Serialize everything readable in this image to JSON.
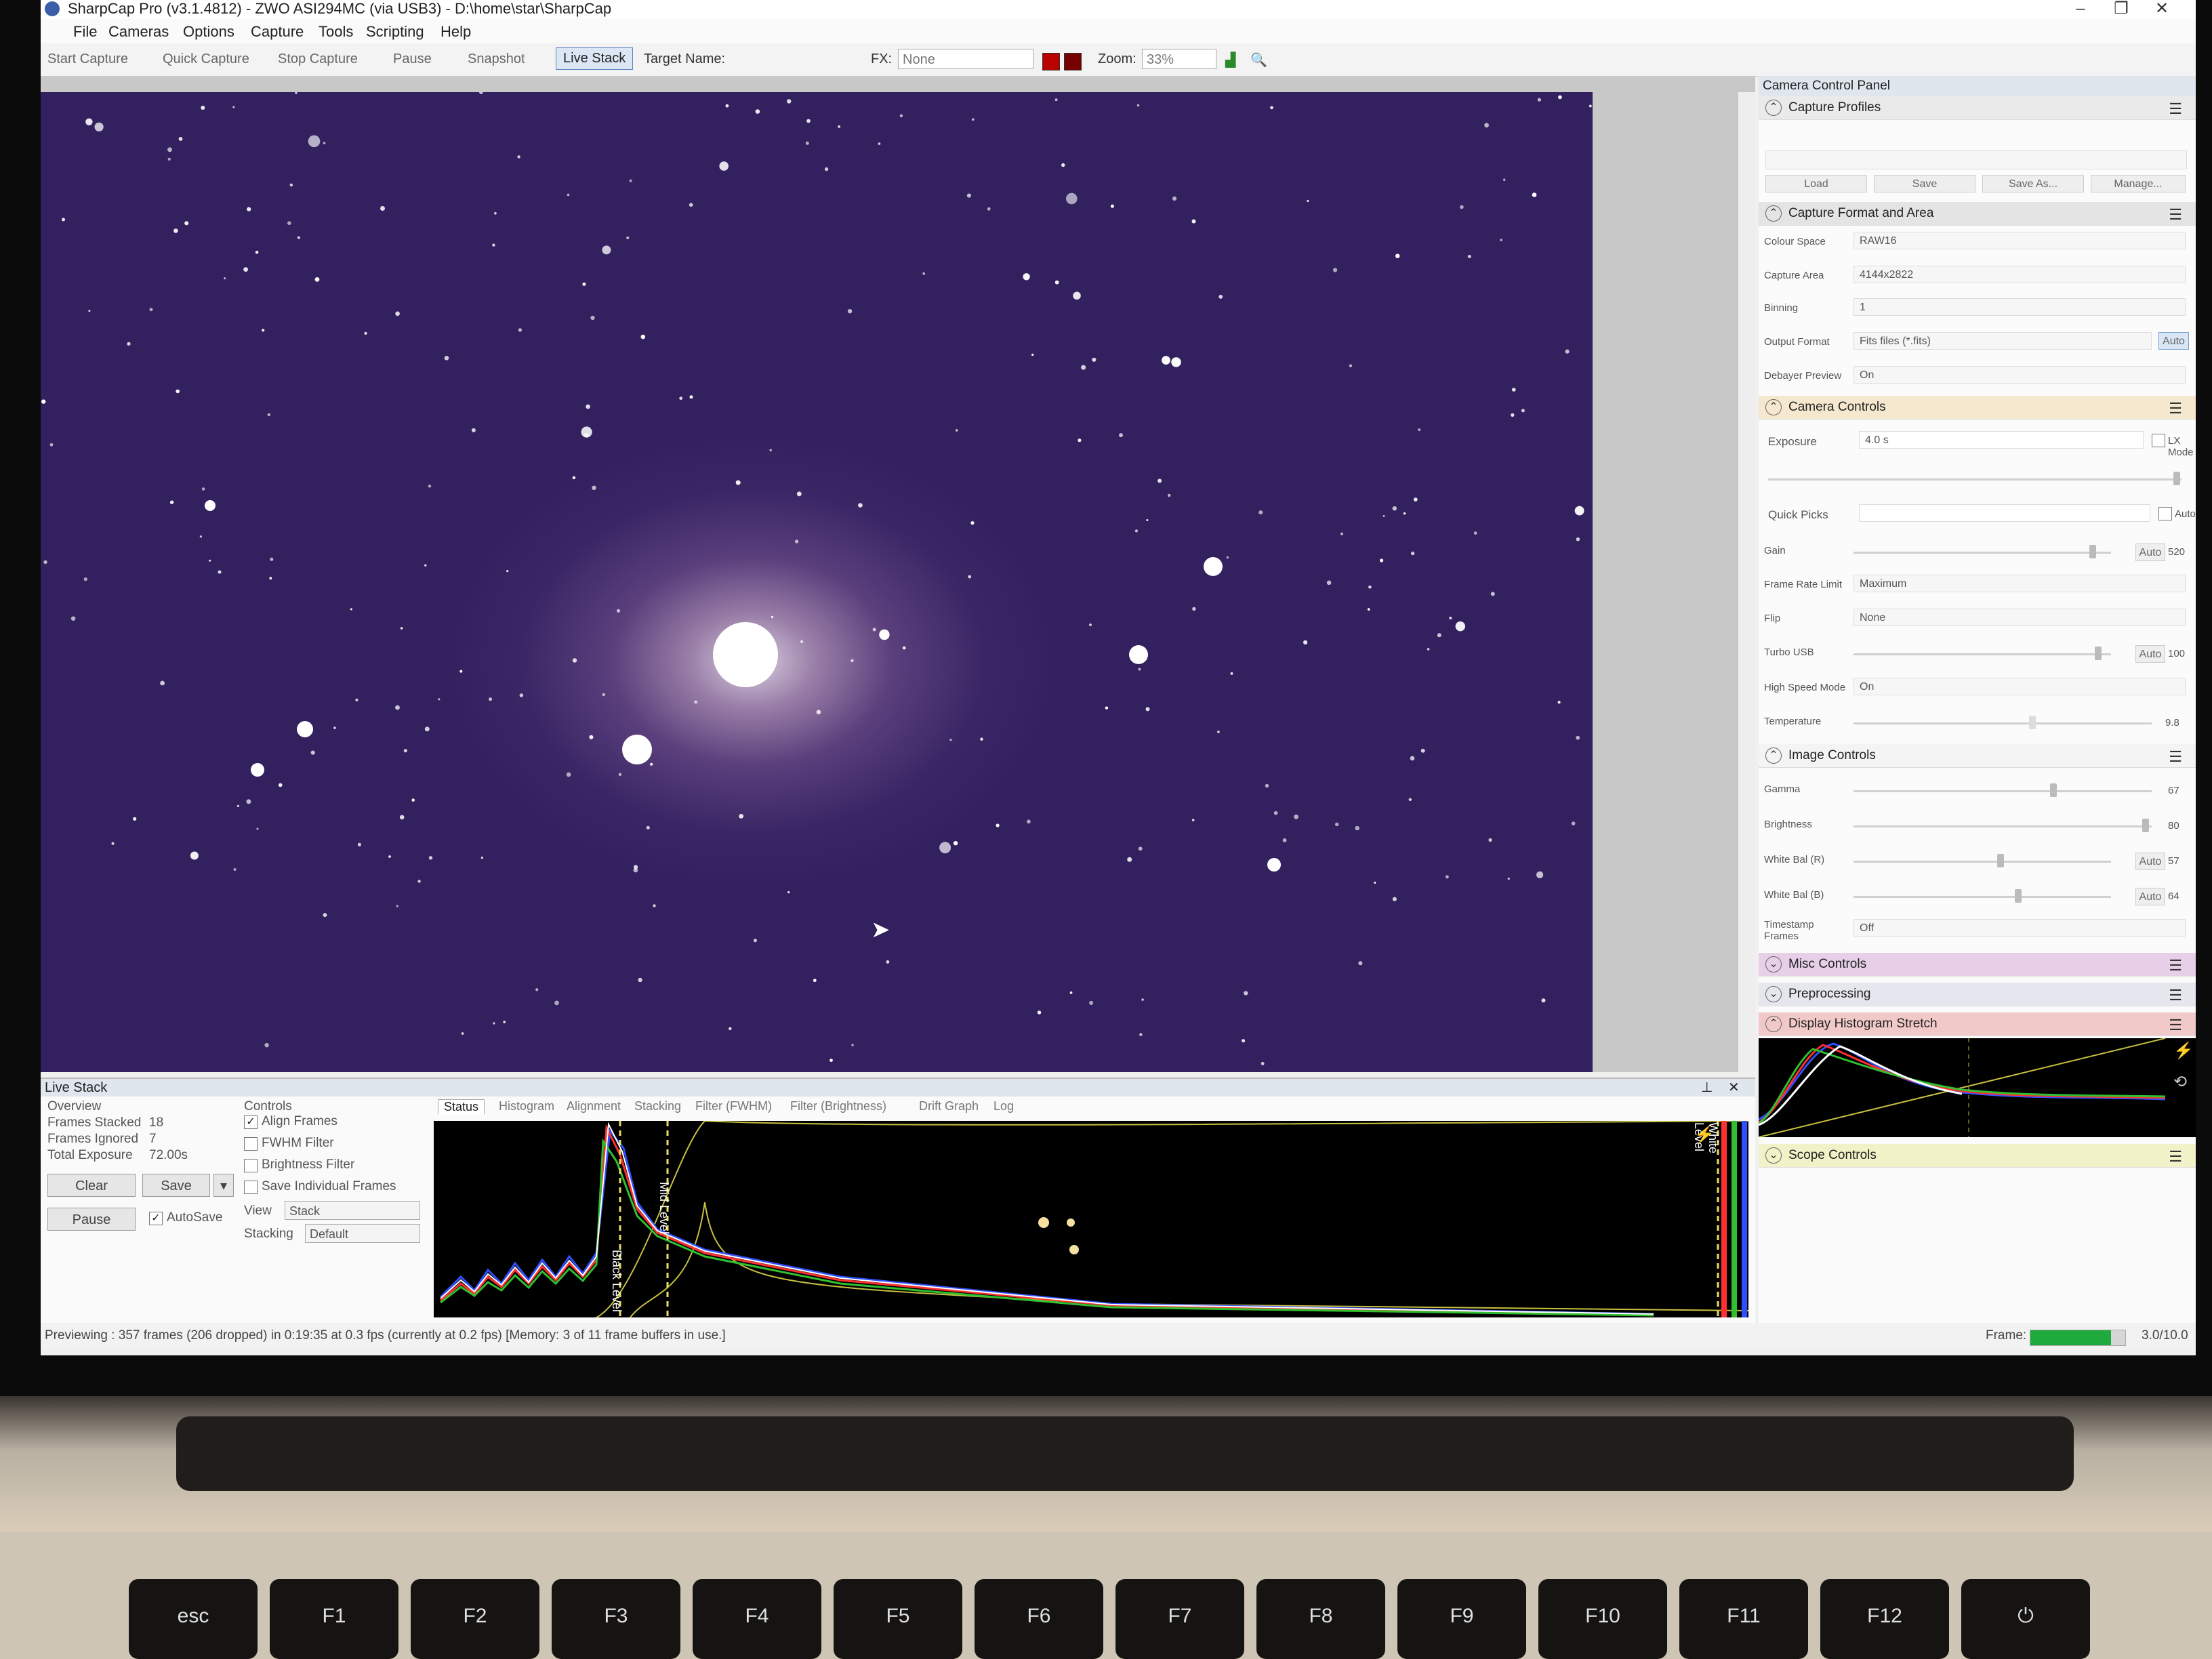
{
  "window": {
    "title": "SharpCap Pro (v3.1.4812) - ZWO ASI294MC (via USB3) - D:\\home\\star\\SharpCap",
    "minimize": "–",
    "maximize": "❐",
    "close": "✕"
  },
  "menu": [
    "File",
    "Cameras",
    "Options",
    "Capture",
    "Tools",
    "Scripting",
    "Help"
  ],
  "toolbar": {
    "start_capture": "Start Capture",
    "quick_capture": "Quick Capture",
    "stop_capture": "Stop Capture",
    "pause": "Pause",
    "snapshot": "Snapshot",
    "live_stack": "Live Stack",
    "target_name_label": "Target Name:",
    "fx_label": "FX:",
    "fx_value": "None",
    "zoom_label": "Zoom:",
    "zoom_value": "33%"
  },
  "camera_panel": {
    "title": "Camera Control Panel",
    "capture_profiles": {
      "label": "Capture Profiles",
      "buttons": [
        "Load",
        "Save",
        "Save As...",
        "Manage..."
      ]
    },
    "capture_format": {
      "label": "Capture Format and Area",
      "colour_space_label": "Colour Space",
      "colour_space": "RAW16",
      "capture_area_label": "Capture Area",
      "capture_area": "4144x2822",
      "binning_label": "Binning",
      "binning": "1",
      "output_format_label": "Output Format",
      "output_format": "Fits files (*.fits)",
      "output_auto": "Auto",
      "debayer_label": "Debayer Preview",
      "debayer": "On"
    },
    "camera_controls": {
      "label": "Camera Controls",
      "exposure_label": "Exposure",
      "exposure": "4.0 s",
      "lx_mode": "LX Mode",
      "quick_picks_label": "Quick Picks",
      "quick_picks_auto": "Auto",
      "gain_label": "Gain",
      "gain_auto": "Auto",
      "gain_value": "520",
      "gain_level": 0.93,
      "frame_rate_label": "Frame Rate Limit",
      "frame_rate": "Maximum",
      "flip_label": "Flip",
      "flip": "None",
      "turbo_label": "Turbo USB",
      "turbo_auto": "Auto",
      "turbo_value": "100",
      "turbo_level": 0.95,
      "high_speed_label": "High Speed Mode",
      "high_speed": "On",
      "temperature_label": "Temperature",
      "temperature_value": "9.8",
      "temperature_level": 0.6
    },
    "image_controls": {
      "label": "Image Controls",
      "gamma_label": "Gamma",
      "gamma_value": "67",
      "gamma_level": 0.67,
      "brightness_label": "Brightness",
      "brightness_value": "80",
      "brightness_level": 0.98,
      "wb_r_label": "White Bal (R)",
      "wb_r_auto": "Auto",
      "wb_r_value": "57",
      "wb_r_level": 0.57,
      "wb_b_label": "White Bal (B)",
      "wb_b_auto": "Auto",
      "wb_b_value": "64",
      "wb_b_level": 0.64,
      "timestamp_label": "Timestamp Frames",
      "timestamp": "Off"
    },
    "misc_controls": "Misc Controls",
    "preprocessing": "Preprocessing",
    "histogram_stretch": "Display Histogram Stretch",
    "scope_controls": "Scope Controls"
  },
  "live_stack": {
    "title": "Live Stack",
    "overview_label": "Overview",
    "frames_stacked_label": "Frames Stacked",
    "frames_stacked": "18",
    "frames_ignored_label": "Frames Ignored",
    "frames_ignored": "7",
    "total_exposure_label": "Total Exposure",
    "total_exposure": "72.00s",
    "clear": "Clear",
    "save": "Save",
    "pause": "Pause",
    "autosave": "AutoSave",
    "controls_label": "Controls",
    "align_frames": "Align Frames",
    "fwhm_filter": "FWHM Filter",
    "brightness_filter": "Brightness Filter",
    "save_individual": "Save Individual Frames",
    "view_label": "View",
    "view_value": "Stack",
    "stacking_label": "Stacking",
    "stacking_value": "Default",
    "tabs": [
      "Status",
      "Histogram",
      "Alignment",
      "Stacking",
      "Filter (FWHM)",
      "Filter (Brightness)",
      "Drift Graph",
      "Log"
    ],
    "black_level": "Black Level",
    "mid_level": "Mid Level",
    "white_level": "White Level"
  },
  "status": {
    "text": "Previewing : 357 frames (206 dropped) in 0:19:35 at 0.3 fps  (currently at 0.2 fps) [Memory: 3 of 11 frame buffers in use.]",
    "frame_label": "Frame:",
    "frame_progress": 0.85,
    "frame_value": "3.0/10.0"
  },
  "keys": [
    "esc",
    "F1",
    "F2",
    "F3",
    "F4",
    "F5",
    "F6",
    "F7",
    "F8",
    "F9",
    "F10",
    "F11",
    "F12",
    "⏻"
  ],
  "colors": {
    "sky": "#3a2665",
    "accent_ls": "#dfe6ee",
    "camera_controls_header": "#f6e8cf",
    "misc_header": "#e8cfe8",
    "preprocessing_header": "#e6e6ee",
    "histogram_header": "#f2c9c9",
    "scope_header": "#f2f2c8",
    "frame_bar": "#1eaa3c"
  }
}
